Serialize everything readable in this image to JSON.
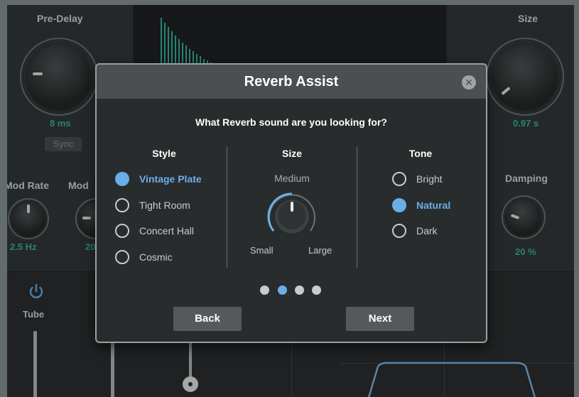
{
  "background": {
    "pre_delay": {
      "label": "Pre-Delay",
      "value": "8 ms",
      "sync_label": "Sync"
    },
    "size": {
      "label": "Size",
      "value": "0.97 s"
    },
    "mod_rate": {
      "label": "Mod Rate",
      "value": "2.5 Hz"
    },
    "mod_depth": {
      "label": "Mod",
      "value": "20"
    },
    "damping": {
      "label": "Damping",
      "value": "20 %"
    },
    "tube": {
      "label": "Tube"
    },
    "colors": {
      "accent_teal": "#35b8a3",
      "panel": "#34383a"
    }
  },
  "dialog": {
    "title": "Reverb Assist",
    "close_icon": "close-icon",
    "question": "What Reverb sound are you looking for?",
    "style": {
      "heading": "Style",
      "options": [
        "Vintage Plate",
        "Tight Room",
        "Concert Hall",
        "Cosmic"
      ],
      "selected": "Vintage Plate"
    },
    "size": {
      "heading": "Size",
      "current": "Medium",
      "min_label": "Small",
      "max_label": "Large"
    },
    "tone": {
      "heading": "Tone",
      "options": [
        "Bright",
        "Natural",
        "Dark"
      ],
      "selected": "Natural"
    },
    "pager": {
      "total": 4,
      "current": 2
    },
    "back_label": "Back",
    "next_label": "Next",
    "accent_color": "#6aaee8"
  }
}
